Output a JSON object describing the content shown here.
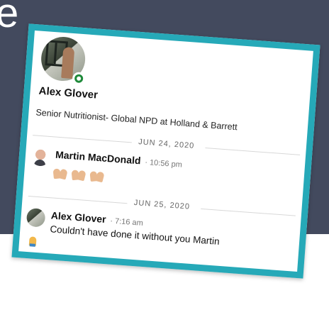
{
  "background": {
    "letter": "e"
  },
  "profile": {
    "name": "Alex Glover",
    "headline": "Senior Nutritionist- Global NPD at Holland & Barrett",
    "status": "online",
    "avatar_icon": "avatar-photo-icon"
  },
  "dates": [
    "JUN 24, 2020",
    "JUN 25, 2020"
  ],
  "messages": [
    {
      "sender": "Martin MacDonald",
      "time": "· 10:56 pm",
      "content_icons": [
        "clapping-hands-icon",
        "clapping-hands-icon",
        "clapping-hands-icon"
      ]
    },
    {
      "sender": "Alex Glover",
      "time": "· 7:16 am",
      "text": "Couldn't have done it without you Martin",
      "content_icons": [
        "folded-hands-icon"
      ]
    }
  ],
  "colors": {
    "frame": "#26a9b8",
    "background": "#434a5e",
    "online": "#1f8a3a"
  }
}
